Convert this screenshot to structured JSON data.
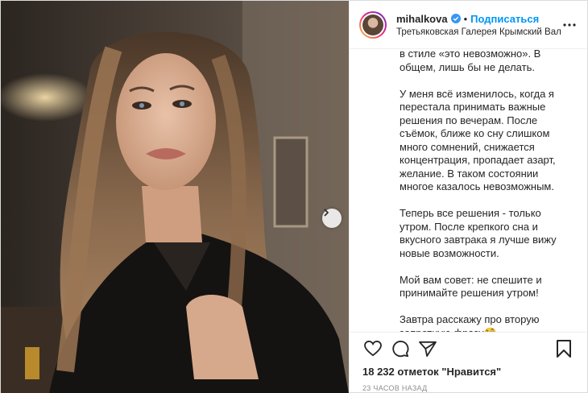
{
  "post": {
    "username": "mihalkova",
    "follow_label": "Подписаться",
    "separator": "•",
    "location": "Третьяковская Галерея Крымский Вал",
    "caption": [
      "в стиле «это невозможно». В общем, лишь бы не делать.",
      "У меня всё изменилось, когда я перестала принимать важные решения по вечерам. После съёмок, ближе ко сну слишком много сомнений, снижается концентрация, пропадает азарт, желание. В таком состоянии многое казалось невозможным.",
      "Теперь все решения - только утром. После крепкого сна и вкусного завтрака я лучше вижу новые возможности.",
      "Мой вам совет: не спешите и принимайте решения утром!",
      "Завтра расскажу про вторую запретную фразу🧐"
    ],
    "likes": "18 232 отметок \"Нравится\"",
    "timestamp": "23 часов назад"
  },
  "icons": {
    "verified": "verified-badge-icon",
    "more": "more-options-icon",
    "like": "heart-icon",
    "comment": "comment-icon",
    "share": "share-icon",
    "save": "bookmark-icon",
    "next": "chevron-right-icon"
  },
  "colors": {
    "accent": "#0095f6",
    "text": "#262626",
    "muted": "#8e8e8e",
    "border": "#efefef"
  }
}
